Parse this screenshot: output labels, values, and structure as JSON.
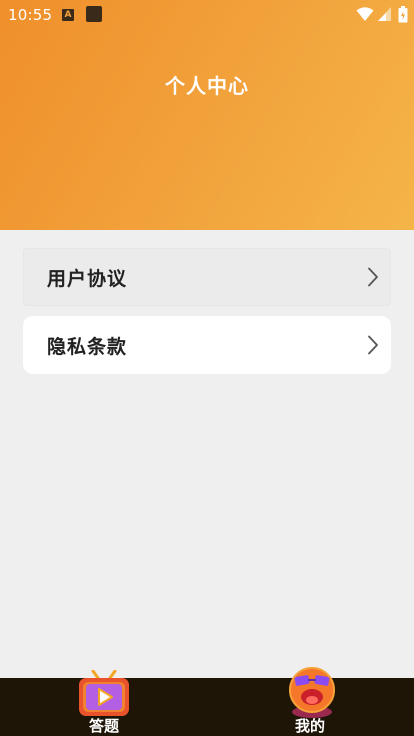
{
  "status_bar": {
    "time": "10:55",
    "icons": [
      "a-notification-icon",
      "app-notification-icon",
      "wifi-icon",
      "signal-icon",
      "battery-icon"
    ]
  },
  "header": {
    "title": "个人中心",
    "gradient_colors": [
      "#ef8f2b",
      "#f5b548"
    ]
  },
  "menu": {
    "items": [
      {
        "label": "用户协议",
        "icon": "chevron-right-icon",
        "state": "pressed"
      },
      {
        "label": "隐私条款",
        "icon": "chevron-right-icon",
        "state": "normal"
      }
    ]
  },
  "tab_bar": {
    "background": "#1e1507",
    "tabs": [
      {
        "label": "答题",
        "icon": "tv-play-icon"
      },
      {
        "label": "我的",
        "icon": "cool-face-icon"
      }
    ]
  }
}
